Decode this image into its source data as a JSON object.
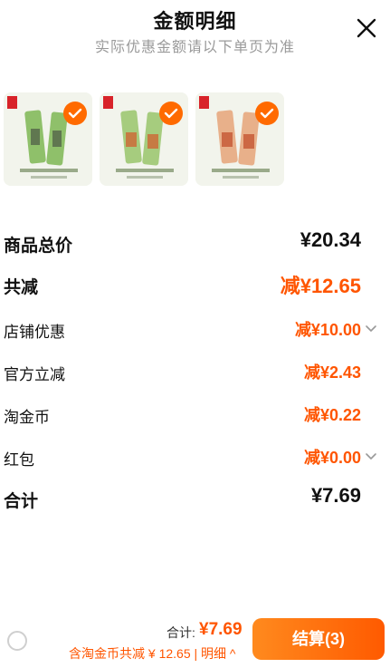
{
  "header": {
    "title": "金额明细",
    "subtitle": "实际优惠金额请以下单页为准"
  },
  "products": [
    {
      "selected": true,
      "color": "#8fc06a"
    },
    {
      "selected": true,
      "color": "#a6cc7e"
    },
    {
      "selected": true,
      "color": "#e39a6a"
    }
  ],
  "rows": {
    "goods_total": {
      "label": "商品总价",
      "value": "¥20.34"
    },
    "total_reduction": {
      "label": "共减",
      "value": "减¥12.65"
    },
    "store_discount": {
      "label": "店铺优惠",
      "value": "减¥10.00"
    },
    "official_reduction": {
      "label": "官方立减",
      "value": "减¥2.43"
    },
    "taojin_coin": {
      "label": "淘金币",
      "value": "减¥0.22"
    },
    "red_packet": {
      "label": "红包",
      "value": "减¥0.00"
    },
    "sum": {
      "label": "合计",
      "value": "¥7.69"
    }
  },
  "footer": {
    "total_label": "合计:",
    "total_value": "¥7.69",
    "saving_text": "含淘金币共减 ¥ 12.65 | 明细 ^",
    "checkout_label": "结算(3)"
  },
  "colors": {
    "accent": "#ff5500",
    "checkout_start": "#ff8a1e",
    "checkout_end": "#ff5a00"
  }
}
